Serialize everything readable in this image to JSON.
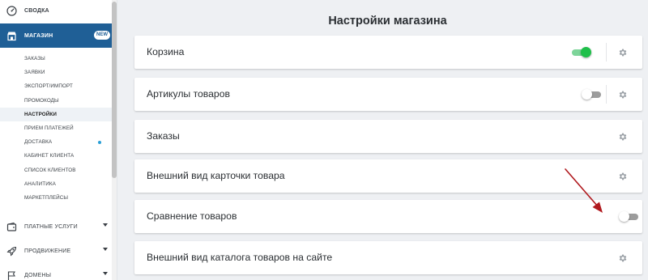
{
  "sidebar": {
    "top_item": {
      "label": "СВОДКА",
      "icon": "gauge-icon"
    },
    "active_item": {
      "label": "МАГАЗИН",
      "badge": "NEW",
      "icon": "store-icon"
    },
    "sub_items": [
      {
        "label": "ЗАКАЗЫ"
      },
      {
        "label": "ЗАЯВКИ"
      },
      {
        "label": "ЭКСПОРТ/ИМПОРТ"
      },
      {
        "label": "ПРОМОКОДЫ"
      },
      {
        "label": "НАСТРОЙКИ"
      },
      {
        "label": "ПРИЕМ ПЛАТЕЖЕЙ"
      },
      {
        "label": "ДОСТАВКА"
      },
      {
        "label": "КАБИНЕТ КЛИЕНТА"
      },
      {
        "label": "СПИСОК КЛИЕНТОВ"
      },
      {
        "label": "АНАЛИТИКА"
      },
      {
        "label": "МАРКЕТПЛЕЙСЫ"
      }
    ],
    "sections": [
      {
        "label": "ПЛАТНЫЕ УСЛУГИ",
        "icon": "wallet-icon"
      },
      {
        "label": "ПРОДВИЖЕНИЕ",
        "icon": "rocket-icon"
      },
      {
        "label": "ДОМЕНЫ",
        "icon": "flag-icon"
      }
    ]
  },
  "main": {
    "title": "Настройки магазина",
    "settings": [
      {
        "label": "Корзина",
        "toggle": "on"
      },
      {
        "label": "Артикулы товаров",
        "toggle": "off"
      },
      {
        "label": "Заказы"
      },
      {
        "label": "Внешний вид карточки товара"
      },
      {
        "label": "Сравнение товаров",
        "toggle": "off"
      },
      {
        "label": "Внешний вид каталога товаров на сайте"
      }
    ]
  },
  "colors": {
    "accent": "#1f5f96",
    "toggle_on": "#1fbf4a",
    "annotation_arrow": "#b0191e"
  }
}
